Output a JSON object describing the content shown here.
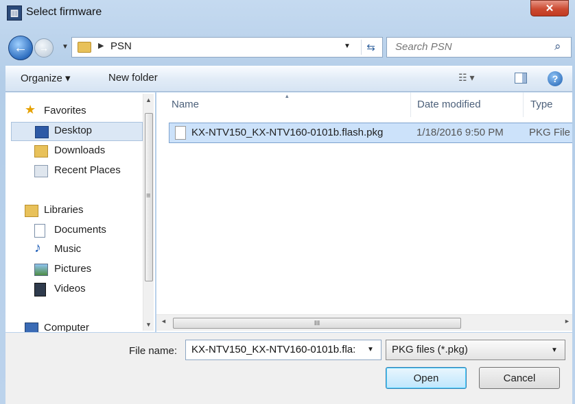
{
  "window": {
    "title": "Select firmware",
    "app_icon_text": "▥",
    "close_glyph": "✕"
  },
  "nav": {
    "back_glyph": "←",
    "forward_glyph": "→",
    "dropdown_glyph": "▼",
    "path_separator": "▶",
    "address_path": "PSN",
    "refresh_glyph": "⇆",
    "search_placeholder": "Search PSN",
    "search_glyph": "⌕"
  },
  "toolbar": {
    "organize_label": "Organize ▾",
    "new_folder_label": "New folder",
    "views_label": "☷ ▾",
    "help_glyph": "?"
  },
  "sidebar": {
    "items": [
      {
        "label": "Favorites",
        "icon": "star-icon",
        "group": true
      },
      {
        "label": "Desktop",
        "icon": "desktop-icon",
        "group": false,
        "selected": true
      },
      {
        "label": "Downloads",
        "icon": "downloads-folder-icon",
        "group": false
      },
      {
        "label": "Recent Places",
        "icon": "recent-places-icon",
        "group": false
      },
      {
        "label": "Libraries",
        "icon": "libraries-icon",
        "group": true
      },
      {
        "label": "Documents",
        "icon": "documents-icon",
        "group": false
      },
      {
        "label": "Music",
        "icon": "music-icon",
        "group": false
      },
      {
        "label": "Pictures",
        "icon": "pictures-icon",
        "group": false
      },
      {
        "label": "Videos",
        "icon": "videos-icon",
        "group": false
      },
      {
        "label": "Computer",
        "icon": "computer-icon",
        "group": true
      }
    ],
    "scroll_up_glyph": "▲",
    "scroll_down_glyph": "▼",
    "scroll_grip": "≡"
  },
  "file_list": {
    "columns": [
      "Name",
      "Date modified",
      "Type"
    ],
    "sort_glyph": "▴",
    "rows": [
      {
        "name": "KX-NTV150_KX-NTV160-0101b.flash.pkg",
        "date": "1/18/2016 9:50 PM",
        "type": "PKG File"
      }
    ],
    "hscroll_left_glyph": "◄",
    "hscroll_right_glyph": "►",
    "hscroll_grip": "III"
  },
  "footer": {
    "file_name_label": "File name:",
    "file_name_value": "KX-NTV150_KX-NTV160-0101b.fla:",
    "file_type_value": "PKG files (*.pkg)",
    "open_label": "Open",
    "cancel_label": "Cancel"
  },
  "colors": {
    "accent": "#3c7fb1",
    "selection": "#cce2fa",
    "close": "#c23b22"
  }
}
